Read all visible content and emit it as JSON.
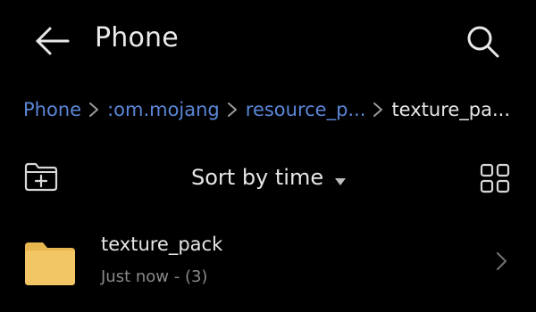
{
  "header": {
    "title": "Phone",
    "back_icon": "arrow-left-icon",
    "search_icon": "search-icon"
  },
  "breadcrumb": {
    "items": [
      {
        "label": "Phone",
        "current": false
      },
      {
        "label": ":om.mojang",
        "current": false
      },
      {
        "label": "resource_p...",
        "current": false
      },
      {
        "label": "texture_pa...",
        "current": true
      }
    ],
    "separator_icon": "chevron-right-icon"
  },
  "toolbar": {
    "new_folder_icon": "folder-add-icon",
    "sort_label": "Sort by time",
    "sort_icon": "caret-down-icon",
    "view_icon": "grid-view-icon"
  },
  "files": [
    {
      "name": "texture_pack",
      "meta": "Just now - (3)",
      "icon": "folder-icon",
      "chevron_icon": "chevron-right-icon"
    }
  ],
  "colors": {
    "background": "#000000",
    "link": "#5b86d6",
    "text": "#e6e6e6",
    "secondary_text": "#8a8a8a",
    "folder": "#f0c35b"
  }
}
